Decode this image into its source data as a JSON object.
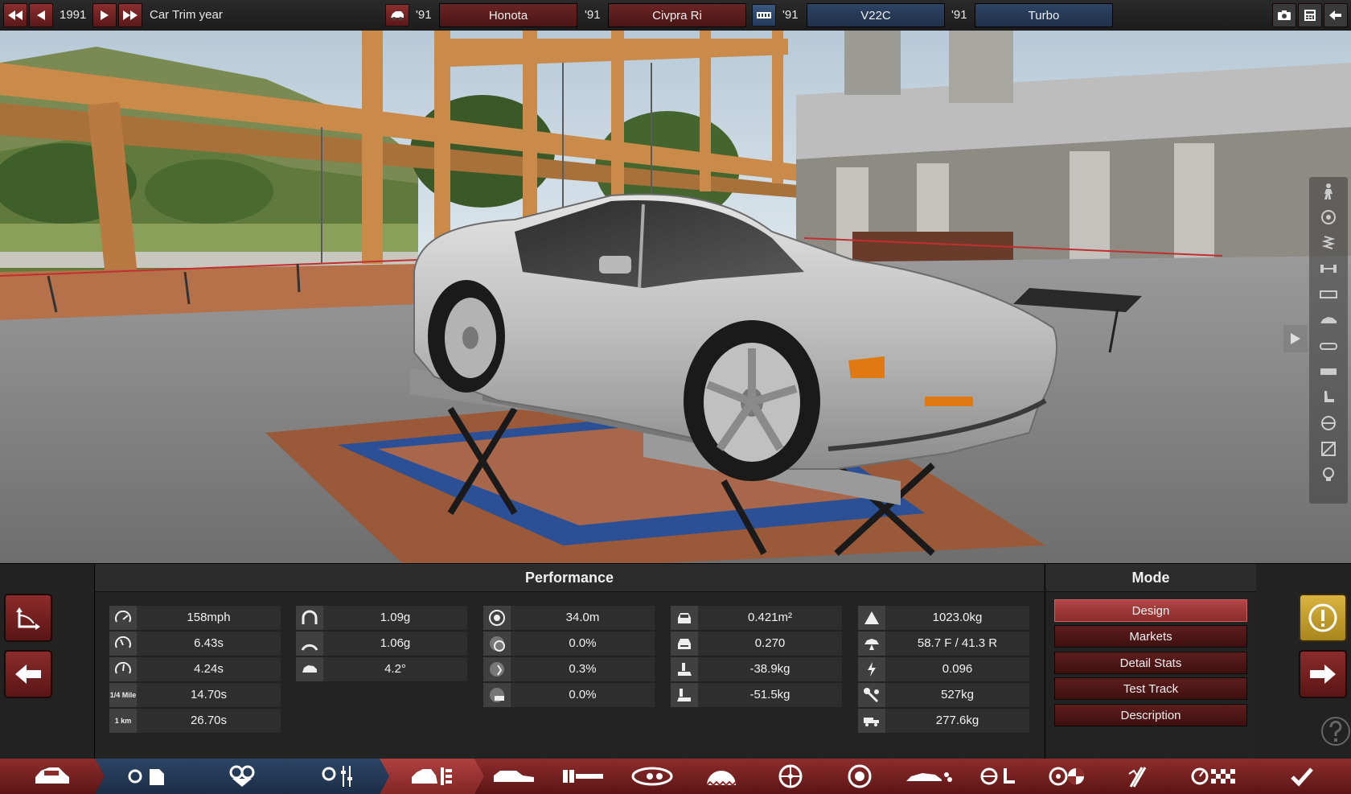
{
  "top_bar": {
    "year": "1991",
    "year_label": "Car Trim year",
    "model_year_1": "'91",
    "model_family": "Honota",
    "model_year_2": "'91",
    "model_trim": "Civpra Ri",
    "engine_year_1": "'91",
    "engine_family": "V22C",
    "engine_year_2": "'91",
    "engine_variant": "Turbo"
  },
  "performance": {
    "title": "Performance",
    "col1": [
      {
        "icon": "top-speed-icon",
        "value": "158mph"
      },
      {
        "icon": "acceleration-0-100-icon",
        "value": "6.43s"
      },
      {
        "icon": "acceleration-0-60-icon",
        "value": "4.24s"
      },
      {
        "icon": "quarter-mile-icon",
        "icon_text": "1/4 Mile",
        "value": "14.70s"
      },
      {
        "icon": "one-km-icon",
        "icon_text": "1 km",
        "value": "26.70s"
      }
    ],
    "col2": [
      {
        "icon": "cornering-low-icon",
        "value": "1.09g"
      },
      {
        "icon": "cornering-high-icon",
        "value": "1.06g"
      },
      {
        "icon": "body-roll-icon",
        "value": "4.2°"
      }
    ],
    "col3": [
      {
        "icon": "braking-distance-icon",
        "value": "34.0m"
      },
      {
        "icon": "brake-fade-icon",
        "value": "0.0%"
      },
      {
        "icon": "brake-fade-hot-icon",
        "value": "0.3%"
      },
      {
        "icon": "brake-lockup-icon",
        "value": "0.0%"
      }
    ],
    "col4": [
      {
        "icon": "frontal-area-icon",
        "value": "0.421m²"
      },
      {
        "icon": "drag-coefficient-icon",
        "value": "0.270"
      },
      {
        "icon": "front-downforce-icon",
        "value": "-38.9kg"
      },
      {
        "icon": "rear-downforce-icon",
        "value": "-51.5kg"
      }
    ],
    "col5": [
      {
        "icon": "weight-icon",
        "value": "1023.0kg"
      },
      {
        "icon": "weight-distribution-icon",
        "value": "58.7 F / 41.3 R"
      },
      {
        "icon": "power-to-weight-icon",
        "value": "0.096"
      },
      {
        "icon": "wrench-weight-icon",
        "value": "527kg"
      },
      {
        "icon": "towing-icon",
        "value": "277.6kg"
      }
    ]
  },
  "mode": {
    "title": "Mode",
    "buttons": [
      "Design",
      "Markets",
      "Detail Stats",
      "Test Track",
      "Description"
    ],
    "active": "Design"
  },
  "toolbar": {
    "items": [
      "car-model-icon",
      "engine-files-icon",
      "engine-design-icon",
      "engine-tune-icon",
      "trim-car-icon",
      "body-icon",
      "chassis-icon",
      "fixtures-icon",
      "suspension-icon",
      "wheels-icon",
      "brakes-icon",
      "aero-icon",
      "interior-icon",
      "steering-icon",
      "tuning-icon",
      "test-track-icon",
      "finish-check-icon"
    ]
  },
  "colors": {
    "accent_red": "#8a2c2c",
    "active_red": "#b24646",
    "accent_blue": "#2c4565",
    "gold": "#d9b43e"
  }
}
